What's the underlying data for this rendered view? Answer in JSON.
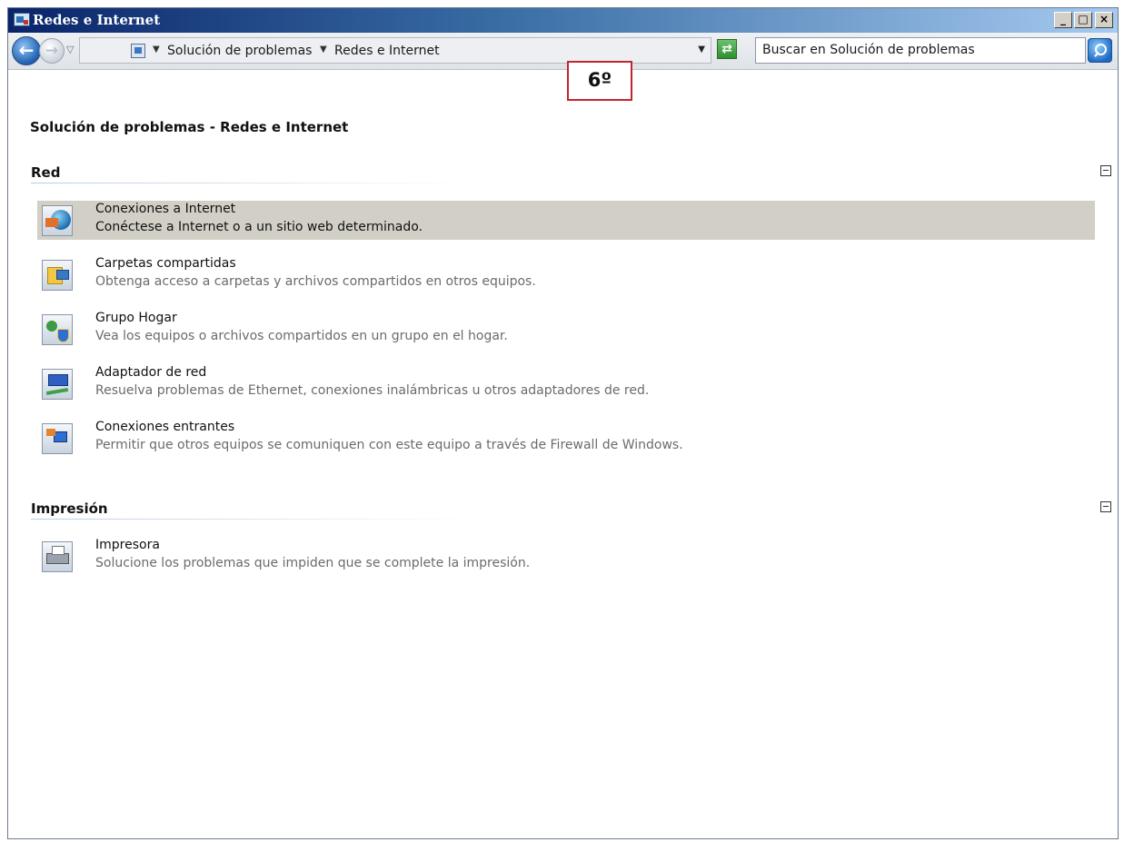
{
  "window": {
    "title": "Redes e Internet",
    "minimize": "_",
    "maximize": "□",
    "close": "×"
  },
  "address_bar": {
    "crumbs": [
      "Solución de problemas",
      "Redes e Internet"
    ],
    "search_placeholder": "Buscar en Solución de problemas"
  },
  "annotation": {
    "label": "6º",
    "color": "#c0262c"
  },
  "page": {
    "title": "Solución de problemas - Redes e Internet"
  },
  "sections": [
    {
      "title": "Red",
      "items": [
        {
          "icon": "internet-connections-icon",
          "title": "Conexiones a Internet",
          "description": "Conéctese a Internet o a un sitio web determinado.",
          "selected": true
        },
        {
          "icon": "shared-folders-icon",
          "title": "Carpetas compartidas",
          "description": "Obtenga acceso a carpetas y archivos compartidos en otros equipos."
        },
        {
          "icon": "homegroup-icon",
          "title": "Grupo Hogar",
          "description": "Vea los equipos o archivos compartidos en un grupo en el hogar."
        },
        {
          "icon": "network-adapter-icon",
          "title": "Adaptador de red",
          "description": "Resuelva problemas de Ethernet, conexiones inalámbricas u otros adaptadores de red."
        },
        {
          "icon": "incoming-connections-icon",
          "title": "Conexiones entrantes",
          "description": "Permitir que otros equipos se comuniquen con este equipo a través de Firewall de Windows."
        }
      ]
    },
    {
      "title": "Impresión",
      "items": [
        {
          "icon": "printer-icon",
          "title": "Impresora",
          "description": "Solucione los problemas que impiden que se complete la impresión."
        }
      ]
    }
  ],
  "colors": {
    "selected_row": "#d2cfc7",
    "title_bar": "#0a246a"
  }
}
